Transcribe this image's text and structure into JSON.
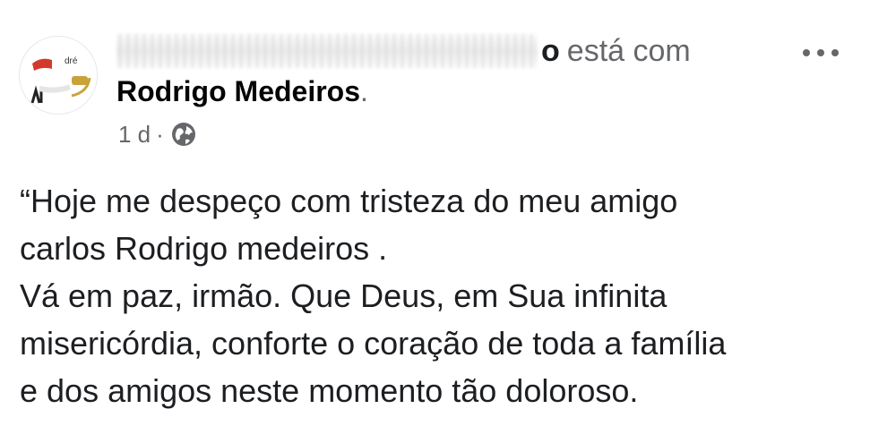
{
  "post": {
    "author_suffix": "o",
    "action_text": "está com",
    "tagged_name": "Rodrigo Medeiros",
    "tagged_suffix": ".",
    "time": "1 d",
    "time_separator": "·",
    "privacy_icon": "globe-icon",
    "more_icon": "more-options-icon",
    "body_lines": [
      "“Hoje me despeço com tristeza do meu amigo",
      "carlos Rodrigo medeiros .",
      "Vá em paz, irmão. Que Deus, em Sua infinita",
      "misericórdia, conforte o coração de toda a família",
      "e dos amigos neste momento tão doloroso."
    ]
  }
}
